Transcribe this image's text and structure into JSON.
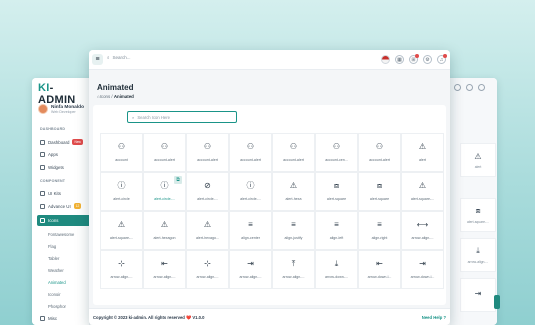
{
  "back_window": {
    "logo": {
      "mark": "KI",
      "text": "-ADMIN"
    },
    "profile": {
      "name": "Ninfa Monaldo",
      "role": "Web Developer"
    },
    "sections": [
      {
        "title": "DASHBOARD"
      },
      {
        "title": "COMPONENT"
      }
    ],
    "nav": [
      {
        "label": "Dashboard",
        "badge": "New",
        "badge_color": "#e04b4b"
      },
      {
        "label": "Apps"
      },
      {
        "label": "Widgets"
      },
      {
        "label": "UI Kits"
      },
      {
        "label": "Advance UI",
        "badge": "12",
        "badge_color": "#f2b233"
      }
    ],
    "active_nav": "Icons",
    "submenu": [
      "Fontawesome",
      "Flag",
      "Tabler",
      "Weather",
      "Animated",
      "Iconoir",
      "Phosphor"
    ],
    "bottom_nav": "Misc",
    "strip_cards": [
      {
        "glyph": "⚠",
        "label": "alert"
      },
      {
        "glyph": "⧈",
        "label": "alert-square-..."
      },
      {
        "glyph": "⤓",
        "label": "arrow-align-..."
      },
      {
        "glyph": "⇥",
        "label": ""
      }
    ]
  },
  "front_window": {
    "search_placeholder": "Search...",
    "page_title": "Animated",
    "breadcrumb": {
      "parent": "Icons",
      "separator": "/",
      "current": "Animated"
    },
    "icon_search_placeholder": "Search Icon Here",
    "icons": [
      {
        "glyph": "⚇",
        "label": "account"
      },
      {
        "glyph": "⚇",
        "label": "account-alert"
      },
      {
        "glyph": "⚇",
        "label": "account-alert"
      },
      {
        "glyph": "⚇",
        "label": "account-alert"
      },
      {
        "glyph": "⚇",
        "label": "account-alert"
      },
      {
        "glyph": "⚇",
        "label": "account-cen..."
      },
      {
        "glyph": "⚇",
        "label": "account-alert"
      },
      {
        "glyph": "⚠",
        "label": "alert"
      },
      {
        "glyph": "ⓘ",
        "label": "alert-circle"
      },
      {
        "glyph": "ⓘ",
        "label": "alert-circle-..."
      },
      {
        "glyph": "⊘",
        "label": "alert-circle-..."
      },
      {
        "glyph": "ⓘ",
        "label": "alert-circle-..."
      },
      {
        "glyph": "⚠",
        "label": "alert-hexa"
      },
      {
        "glyph": "⧈",
        "label": "alert-square"
      },
      {
        "glyph": "⧈",
        "label": "alert-square"
      },
      {
        "glyph": "⚠",
        "label": "alert-square-..."
      },
      {
        "glyph": "⚠",
        "label": "alert-square-..."
      },
      {
        "glyph": "⚠",
        "label": "alert-hexagon"
      },
      {
        "glyph": "⚠",
        "label": "alert-hexago..."
      },
      {
        "glyph": "≡",
        "label": "align-center"
      },
      {
        "glyph": "≡",
        "label": "align-justify"
      },
      {
        "glyph": "≡",
        "label": "align-left"
      },
      {
        "glyph": "≡",
        "label": "align-right"
      },
      {
        "glyph": "⟷",
        "label": "arrow-align-..."
      },
      {
        "glyph": "⊹",
        "label": "arrow-align-..."
      },
      {
        "glyph": "⇤",
        "label": "arrow-align-..."
      },
      {
        "glyph": "⊹",
        "label": "arrow-align-..."
      },
      {
        "glyph": "⇥",
        "label": "arrow-align-..."
      },
      {
        "glyph": "⤒",
        "label": "arrow-align-..."
      },
      {
        "glyph": "⤓",
        "label": "arrow-down-..."
      },
      {
        "glyph": "⇤",
        "label": "arrow-down-l..."
      },
      {
        "glyph": "⇥",
        "label": "arrow-down-l..."
      }
    ],
    "highlight_index": 9,
    "footer": {
      "copyright": "Copyright © 2023 ki-admin. All rights reserved ❤️ V1.0.0",
      "help": "Need Help ?"
    }
  },
  "colors": {
    "accent": "#1a9488",
    "danger": "#e04b4b"
  }
}
